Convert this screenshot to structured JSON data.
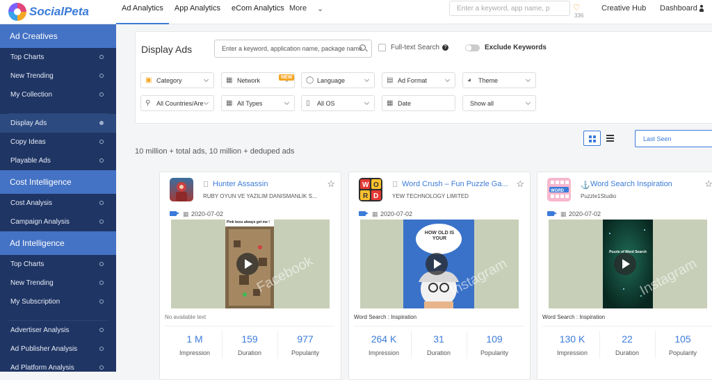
{
  "brand": {
    "name": "SocialPeta"
  },
  "topnav": {
    "items": [
      "Ad Analytics",
      "App Analytics",
      "eCom Analytics"
    ],
    "more": "More",
    "search_placeholder": "Enter a keyword, app name, p",
    "favorites_count": "336",
    "creative_hub": "Creative Hub",
    "dashboard": "Dashboard"
  },
  "sidebar": {
    "sections": [
      {
        "title": "Ad Creatives",
        "items": [
          "Top Charts",
          "New Trending",
          "My Collection"
        ]
      },
      {
        "title": "",
        "items": [
          "Display Ads",
          "Copy Ideas",
          "Playable Ads"
        ]
      },
      {
        "title": "Cost Intelligence",
        "items": [
          "Cost Analysis",
          "Campaign Analysis"
        ]
      },
      {
        "title": "Ad Intelligence",
        "items": [
          "Top Charts",
          "New Trending",
          "My Subscription"
        ]
      },
      {
        "title": "",
        "items": [
          "Advertiser Analysis",
          "Ad Publisher Analysis",
          "Ad Platform Analysis"
        ]
      }
    ],
    "active_item": "Display Ads"
  },
  "filters": {
    "title": "Display Ads",
    "keyword_placeholder": "Enter a keyword, application name, package name",
    "fulltext_label": "Full-text Search",
    "fulltext_checked": false,
    "exclude_label": "Exclude Keywords",
    "exclude_on": false,
    "row1": [
      "Category",
      "Network",
      "Language",
      "Ad Format",
      "Theme"
    ],
    "new_badge": "NEW",
    "row2": [
      "All Countries/Are",
      "All Types",
      "All OS",
      "Date",
      "Show all"
    ]
  },
  "results": {
    "summary": "10 million + total ads, 10 million + deduped ads",
    "sort": "Last Seen"
  },
  "cards": [
    {
      "app_name": "Hunter Assassin",
      "platform": "ios",
      "publisher": "RUBY OYUN VE YAZILIM DANISMANLIK S...",
      "date": "2020-07-02",
      "media_caption": "Pink boss always get me !",
      "watermark": "Facebook",
      "caption": "No available text",
      "stats": [
        {
          "value": "1 M",
          "label": "Impression"
        },
        {
          "value": "159",
          "label": "Duration"
        },
        {
          "value": "977",
          "label": "Popularity"
        }
      ]
    },
    {
      "app_name": "Word Crush – Fun Puzzle Ga...",
      "platform": "ios",
      "publisher": "YEW TECHNOLOGY LIMITED",
      "date": "2020-07-02",
      "media_caption": "HOW OLD IS YOUR",
      "watermark": "Instagram",
      "caption": "Word Search : Inspiration",
      "stats": [
        {
          "value": "264 K",
          "label": "Impression"
        },
        {
          "value": "31",
          "label": "Duration"
        },
        {
          "value": "109",
          "label": "Popularity"
        }
      ]
    },
    {
      "app_name": "Word Search Inspiration",
      "platform": "android",
      "publisher": "Puzzle1Studio",
      "date": "2020-07-02",
      "media_caption": "Puzzle of Word Search",
      "watermark": "Instagram",
      "caption": "Word Search : Inspiration",
      "stats": [
        {
          "value": "130 K",
          "label": "Impression"
        },
        {
          "value": "22",
          "label": "Duration"
        },
        {
          "value": "105",
          "label": "Popularity"
        }
      ]
    }
  ],
  "colors": {
    "accent": "#3b7bd9",
    "sidebar": "#1f3564",
    "sidebar_header": "#4472c4",
    "favorite": "#f39c3c"
  }
}
